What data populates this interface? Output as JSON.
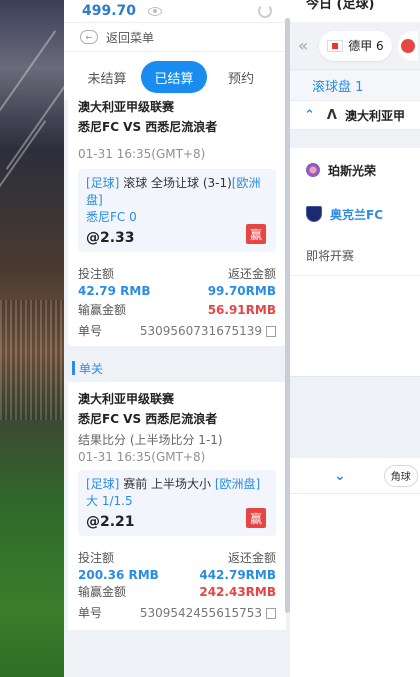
{
  "balance": {
    "amount": "499.70"
  },
  "nav": {
    "back_label": "返回菜单"
  },
  "tabs": [
    {
      "label": "未结算",
      "active": false
    },
    {
      "label": "已结算",
      "active": true
    },
    {
      "label": "预约",
      "active": false
    }
  ],
  "bets": [
    {
      "league": "澳大利亚甲级联赛",
      "teams": "悉尼FC VS 西悉尼流浪者",
      "result": "",
      "time": "01-31 16:35(GMT+8)",
      "sport_tag": "[足球]",
      "market": "滚球 全场让球 (3-1)",
      "market_tag": "[欧洲盘]",
      "selection": "悉尼FC 0",
      "odds": "@2.33",
      "win_badge": "赢",
      "stake_label": "投注额",
      "stake": "42.79 RMB",
      "return_label": "返还金额",
      "return": "99.70RMB",
      "winloss_label": "输赢金额",
      "winloss": "56.91RMB",
      "order_label": "单号",
      "order_no": "5309560731675139"
    },
    {
      "league": "澳大利亚甲级联赛",
      "teams": "悉尼FC VS 西悉尼流浪者",
      "result": "结果比分 (上半场比分 1-1)",
      "time": "01-31 16:35(GMT+8)",
      "sport_tag": "[足球]",
      "market": "赛前 上半场大小",
      "market_tag": "[欧洲盘]",
      "selection": "大 1/1.5",
      "odds": "@2.21",
      "win_badge": "赢",
      "stake_label": "投注额",
      "stake": "200.36 RMB",
      "return_label": "返还金额",
      "return": "442.79RMB",
      "winloss_label": "输赢金额",
      "winloss": "242.43RMB",
      "order_label": "单号",
      "order_no": "5309542455615753"
    }
  ],
  "section": {
    "single_label": "单关"
  },
  "right": {
    "top_text": "今日 (足球)",
    "league_chip_label": "德甲 6",
    "inplay_label": "滚球盘 1",
    "league_name": "澳大利亚甲",
    "team1": "珀斯光荣",
    "team2": "奥克兰FC",
    "soon_label": "即将开赛",
    "corner_label": "角球"
  }
}
